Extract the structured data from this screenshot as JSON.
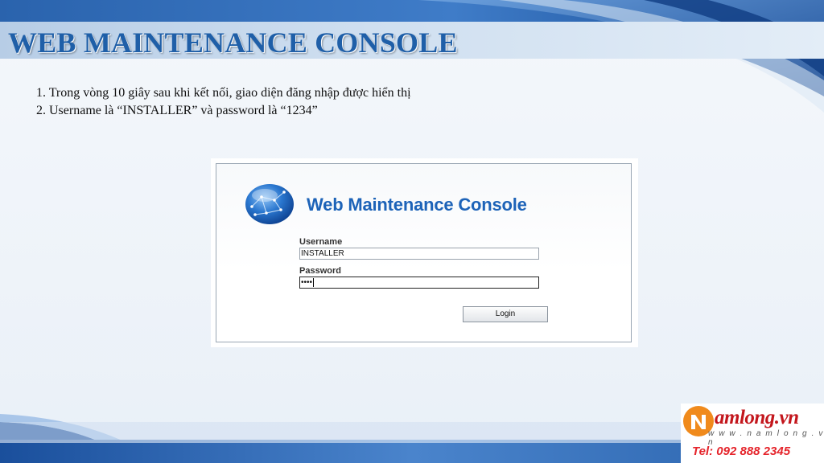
{
  "slide": {
    "title": "WEB MAINTENANCE CONSOLE",
    "instructions": [
      "1. Trong vòng 10 giây sau khi kết nối, giao diện đăng nhập được hiển thị",
      "2. Username là “INSTALLER” và password là “1234”"
    ]
  },
  "login_screen": {
    "title": "Web Maintenance Console",
    "username_label": "Username",
    "username_value": "INSTALLER",
    "password_label": "Password",
    "password_value": "••••",
    "login_label": "Login",
    "logo_icon": "globe-network-icon"
  },
  "brand": {
    "logo_icon": "namlong-n-icon",
    "name": "amlong.vn",
    "website": "w w w . n a m l o n g . v n",
    "phone": "Tel: 092 888 2345",
    "color_red": "#c3161c",
    "color_orange": "#f08a1c"
  },
  "colors": {
    "title_blue": "#1f5fa8",
    "console_blue": "#1d63b8",
    "band_dark": "#1a4f9c",
    "band_light": "#5a8fd0"
  }
}
